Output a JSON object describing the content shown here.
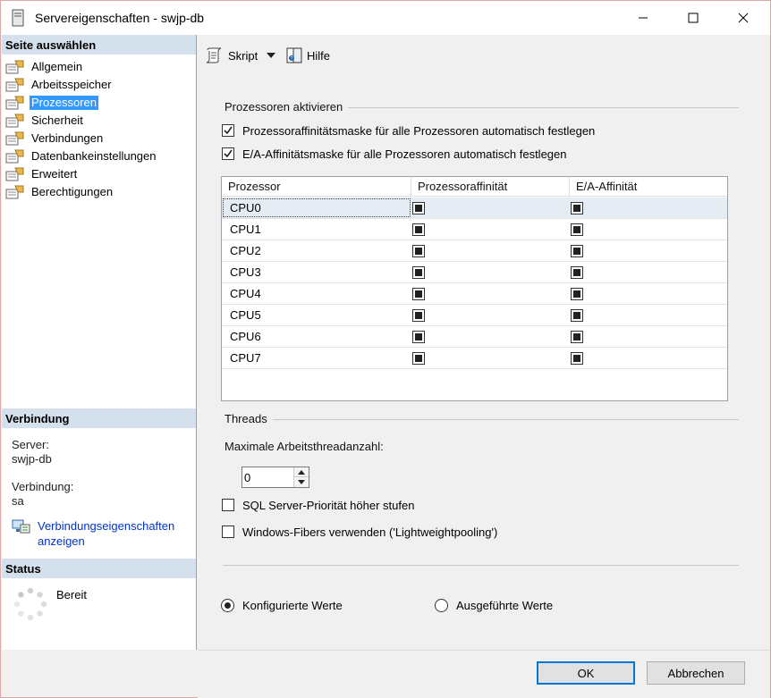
{
  "window": {
    "title": "Servereigenschaften - swjp-db"
  },
  "left": {
    "select_page_header": "Seite auswählen",
    "pages": [
      {
        "label": "Allgemein",
        "selected": false
      },
      {
        "label": "Arbeitsspeicher",
        "selected": false
      },
      {
        "label": "Prozessoren",
        "selected": true
      },
      {
        "label": "Sicherheit",
        "selected": false
      },
      {
        "label": "Verbindungen",
        "selected": false
      },
      {
        "label": "Datenbankeinstellungen",
        "selected": false
      },
      {
        "label": "Erweitert",
        "selected": false
      },
      {
        "label": "Berechtigungen",
        "selected": false
      }
    ],
    "connection_header": "Verbindung",
    "server_label": "Server:",
    "server_value": "swjp-db",
    "connection_label": "Verbindung:",
    "connection_value": "sa",
    "connection_link": "Verbindungseigenschaften anzeigen",
    "status_header": "Status",
    "status_value": "Bereit"
  },
  "toolbar": {
    "script_label": "Skript",
    "help_label": "Hilfe"
  },
  "main": {
    "enable_group_title": "Prozessoren aktivieren",
    "auto_proc_affinity_label": "Prozessoraffinitätsmaske für alle Prozessoren automatisch festlegen",
    "auto_proc_affinity_checked": true,
    "auto_io_affinity_label": "E/A-Affinitätsmaske für alle Prozessoren automatisch festlegen",
    "auto_io_affinity_checked": true,
    "grid": {
      "columns": [
        "Prozessor",
        "Prozessoraffinität",
        "E/A-Affinität"
      ],
      "rows": [
        {
          "name": "CPU0",
          "proc_affinity": "indeterminate",
          "io_affinity": "indeterminate"
        },
        {
          "name": "CPU1",
          "proc_affinity": "indeterminate",
          "io_affinity": "indeterminate"
        },
        {
          "name": "CPU2",
          "proc_affinity": "indeterminate",
          "io_affinity": "indeterminate"
        },
        {
          "name": "CPU3",
          "proc_affinity": "indeterminate",
          "io_affinity": "indeterminate"
        },
        {
          "name": "CPU4",
          "proc_affinity": "indeterminate",
          "io_affinity": "indeterminate"
        },
        {
          "name": "CPU5",
          "proc_affinity": "indeterminate",
          "io_affinity": "indeterminate"
        },
        {
          "name": "CPU6",
          "proc_affinity": "indeterminate",
          "io_affinity": "indeterminate"
        },
        {
          "name": "CPU7",
          "proc_affinity": "indeterminate",
          "io_affinity": "indeterminate"
        }
      ]
    },
    "threads_group_title": "Threads",
    "max_threads_label": "Maximale Arbeitsthreadanzahl:",
    "max_threads_value": "0",
    "boost_priority_label": "SQL Server-Priorität höher stufen",
    "boost_priority_checked": false,
    "fibers_label": "Windows-Fibers verwenden ('Lightweightpooling')",
    "fibers_checked": false,
    "configured_values_label": "Konfigurierte Werte",
    "configured_values_selected": true,
    "running_values_label": "Ausgeführte Werte",
    "running_values_selected": false
  },
  "buttons": {
    "ok_label": "OK",
    "cancel_label": "Abbrechen"
  },
  "colors": {
    "selection": "#3399ff",
    "section_header": "#d4e0ec",
    "link": "#0033cc",
    "accent": "#0078d7"
  }
}
